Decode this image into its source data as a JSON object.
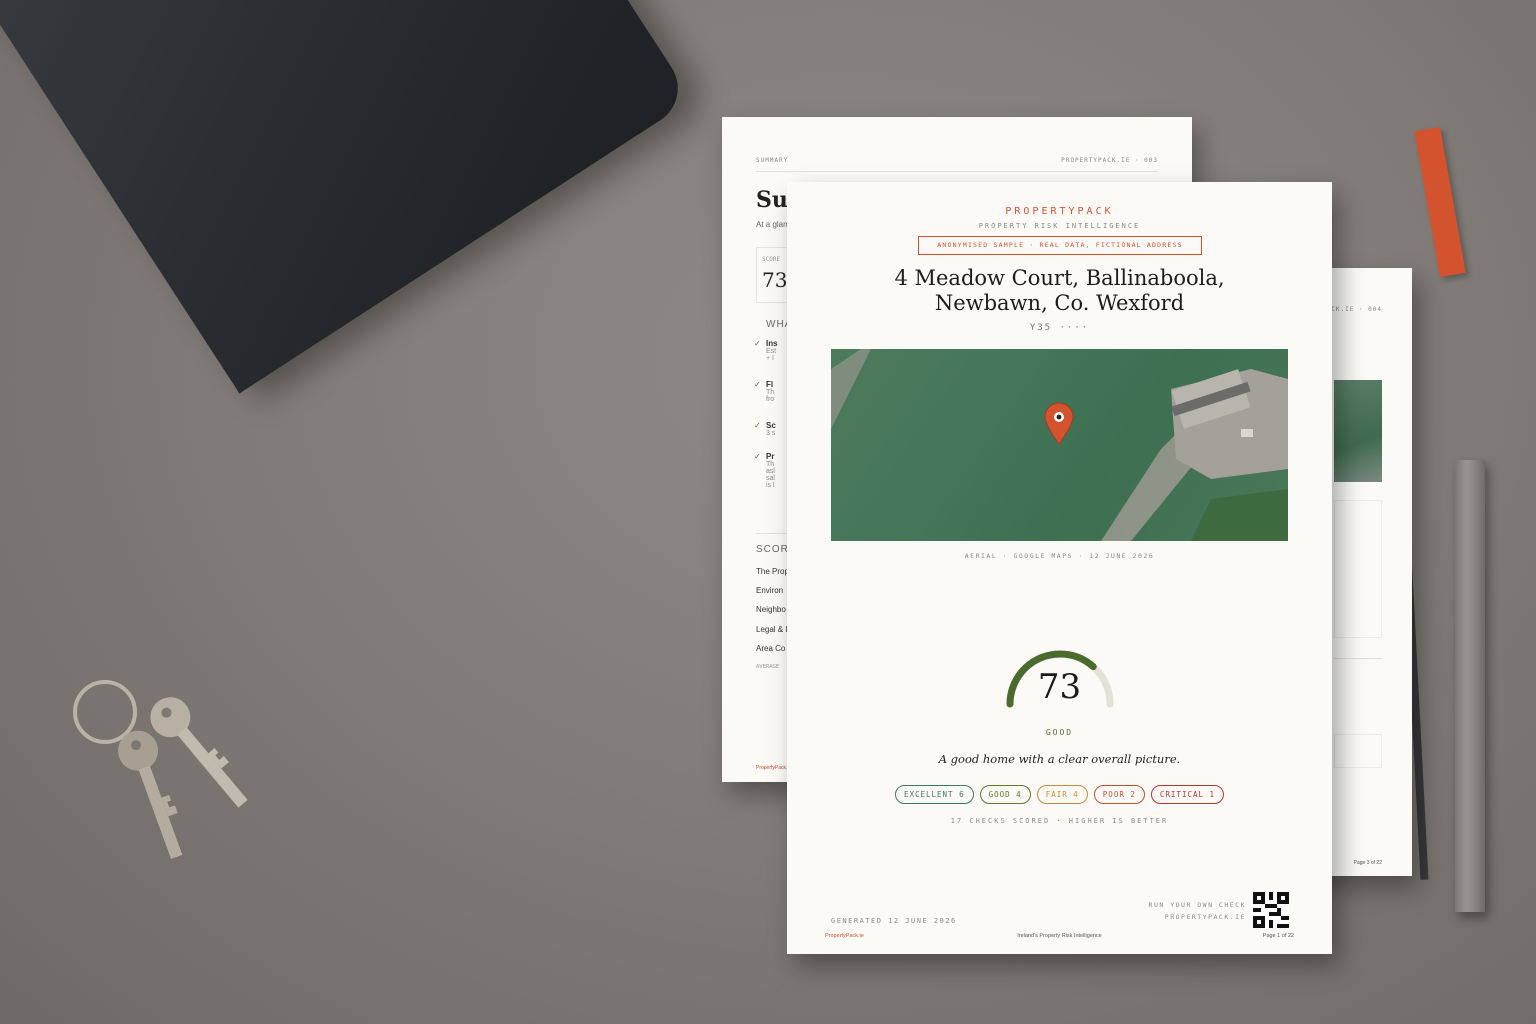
{
  "back_page": {
    "header_left": "SUMMARY",
    "header_right": "PROPERTYPACK.IE · 003",
    "title": "Sur",
    "subtitle": "At a glan",
    "score_label": "SCORE",
    "score": "73",
    "section_what": "WHA",
    "checks": [
      {
        "title": "Ins",
        "lines": [
          "Est",
          "+ I"
        ]
      },
      {
        "title": "Fl",
        "lines": [
          "Th",
          "fro"
        ]
      },
      {
        "title": "Sc",
        "lines": [
          "3 s"
        ]
      },
      {
        "title": "Pr",
        "lines": [
          "Th",
          "asl",
          "sal",
          "is l"
        ]
      }
    ],
    "section_score": "SCOR",
    "score_rows": [
      "The Prop",
      "Environ",
      "Neighbo",
      "Legal & I",
      "Area Co"
    ],
    "average_label": "AVERAGE",
    "footer": "PropertyPack.ie"
  },
  "right_page": {
    "header": "CK.IE · 004",
    "footer": "Page 3 of 22"
  },
  "front_page": {
    "brand": "PROPERTYPACK",
    "tagline": "PROPERTY RISK INTELLIGENCE",
    "sample_badge": "ANONYMISED SAMPLE · REAL DATA, FICTIONAL ADDRESS",
    "address_line1": "4 Meadow Court, Ballinaboola,",
    "address_line2": "Newbawn, Co. Wexford",
    "eircode": "Y35 ····",
    "map_caption": "AERIAL · GOOGLE MAPS · 12 JUNE 2026",
    "score": "73",
    "score_fraction": 0.73,
    "grade": "GOOD",
    "verdict": "A good home with a clear overall picture.",
    "pills": [
      {
        "label": "EXCELLENT 6",
        "color": "#3f7a5a"
      },
      {
        "label": "GOOD 4",
        "color": "#5c7a2e"
      },
      {
        "label": "FAIR 4",
        "color": "#c98a3a"
      },
      {
        "label": "POOR 2",
        "color": "#c7502e"
      },
      {
        "label": "CRITICAL 1",
        "color": "#b8362c"
      }
    ],
    "checks_line": "17 CHECKS SCORED · HIGHER IS BETTER",
    "run_check_line1": "RUN YOUR OWN CHECK",
    "run_check_line2": "PROPERTYPACK.IE",
    "generated": "GENERATED 12 JUNE 2026",
    "footer_left": "PropertyPack.ie",
    "footer_center": "Ireland's Property Risk Intelligence",
    "footer_right": "Page 1 of 22"
  },
  "colors": {
    "accent": "#d4532f",
    "gauge_fill": "#4b6b2e",
    "gauge_track": "#e3e1d8"
  }
}
